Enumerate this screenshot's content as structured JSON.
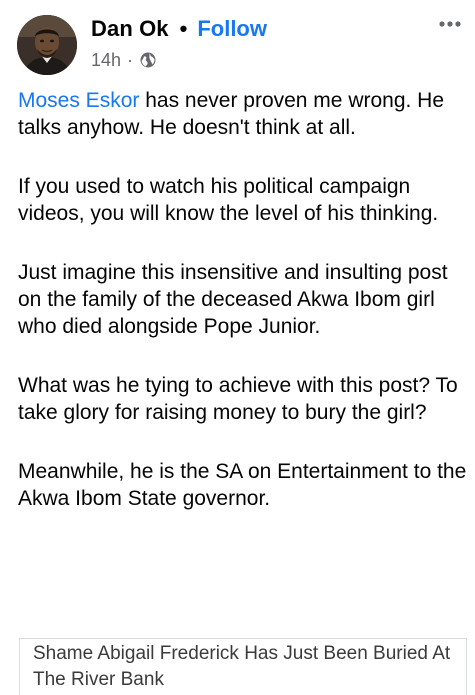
{
  "post": {
    "author": "Dan Ok",
    "separator": "•",
    "follow_label": "Follow",
    "time": "14h",
    "meta_dot": "·",
    "privacy_icon": "globe-icon",
    "more_icon": "more-horizontal-icon",
    "mention": "Moses Eskor",
    "paragraphs": [
      " has never proven me wrong. He talks anyhow. He doesn't think at all.",
      "If you used to watch his political campaign videos, you will know the level of his thinking.",
      "Just imagine this insensitive and insulting post on the family of the deceased Akwa Ibom girl who died alongside Pope Junior.",
      "What was he tying to achieve with this post? To take glory for raising money to bury the girl?",
      "Meanwhile, he is the SA on Entertainment to the Akwa Ibom State governor."
    ],
    "link_preview": {
      "title": "Shame Abigail Frederick Has Just Been Buried At The River Bank"
    }
  },
  "colors": {
    "link": "#1877f2",
    "text": "#050505",
    "meta": "#65676b"
  }
}
